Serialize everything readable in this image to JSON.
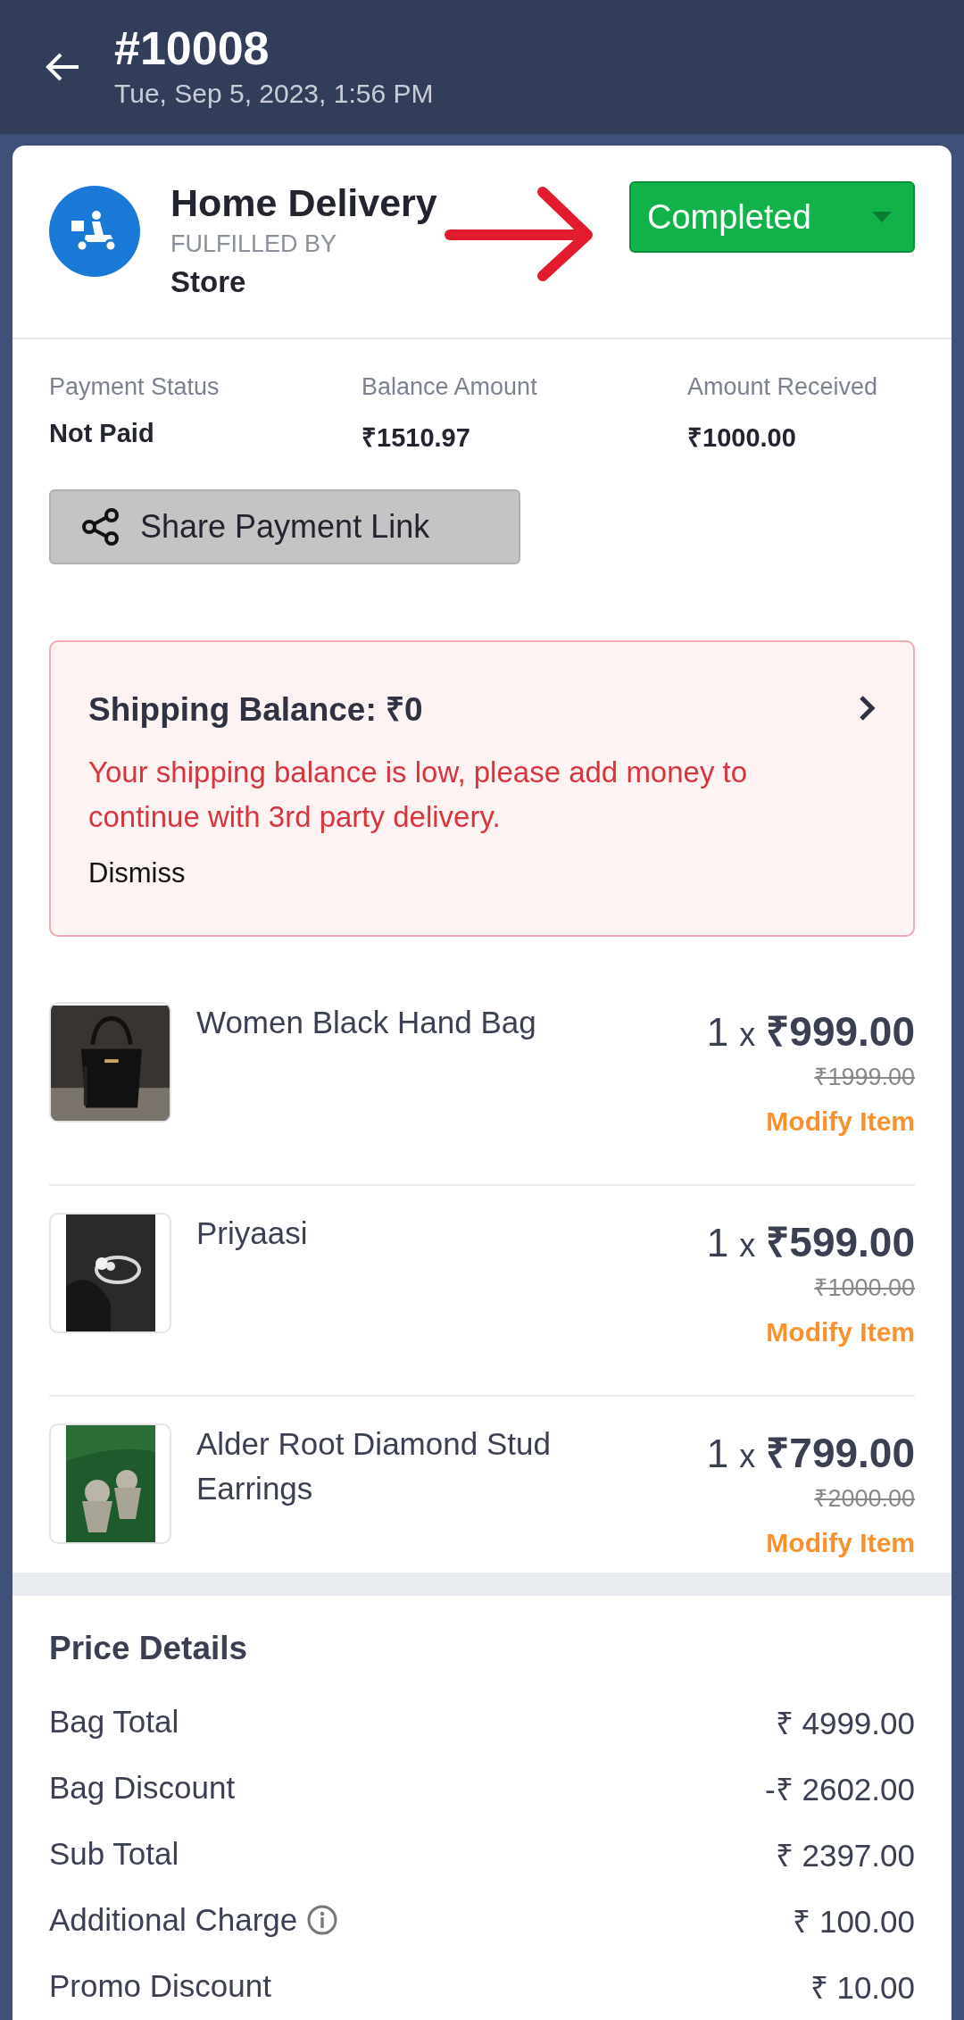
{
  "header": {
    "order_number": "#10008",
    "date": "Tue, Sep 5, 2023, 1:56 PM"
  },
  "delivery": {
    "title": "Home Delivery",
    "fulfilled_label": "FULFILLED BY",
    "fulfilled_by": "Store",
    "status": "Completed"
  },
  "payment": [
    {
      "label": "Payment Status",
      "value": "Not Paid"
    },
    {
      "label": "Balance Amount",
      "value": "₹1510.97"
    },
    {
      "label": "Amount Received",
      "value": "₹1000.00"
    }
  ],
  "share_button": "Share Payment Link",
  "shipping_alert": {
    "title": "Shipping Balance: ₹0",
    "message": "Your shipping balance is low, please add money to continue with 3rd party delivery.",
    "dismiss": "Dismiss"
  },
  "items": [
    {
      "name": "Women Black Hand Bag",
      "quantity": "1",
      "times": "x",
      "price": "₹999.00",
      "original_price": "₹1999.00",
      "action": "Modify Item",
      "kind": "bag"
    },
    {
      "name": "Priyaasi",
      "quantity": "1",
      "times": "x",
      "price": "₹599.00",
      "original_price": "₹1000.00",
      "action": "Modify Item",
      "kind": "ring"
    },
    {
      "name": "Alder Root Diamond Stud Earrings",
      "quantity": "1",
      "times": "x",
      "price": "₹799.00",
      "original_price": "₹2000.00",
      "action": "Modify Item",
      "kind": "earrings"
    }
  ],
  "price_details": {
    "title": "Price Details",
    "rows": [
      {
        "label": "Bag Total",
        "value": "₹ 4999.00",
        "info": false
      },
      {
        "label": "Bag Discount",
        "value": "-₹ 2602.00",
        "info": false
      },
      {
        "label": "Sub Total",
        "value": "₹ 2397.00",
        "info": false
      },
      {
        "label": "Additional Charge",
        "value": "₹ 100.00",
        "info": true
      },
      {
        "label": "Promo Discount",
        "value": "₹ 10.00",
        "info": false
      }
    ]
  }
}
